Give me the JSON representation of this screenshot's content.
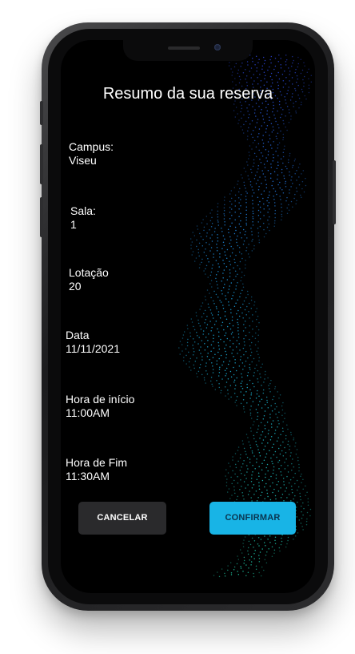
{
  "screen": {
    "title": "Resumo da sua reserva"
  },
  "fields": {
    "campus": {
      "label": "Campus:",
      "value": "Viseu"
    },
    "sala": {
      "label": "Sala:",
      "value": "1"
    },
    "lotacao": {
      "label": "Lotação",
      "value": "20"
    },
    "data": {
      "label": "Data",
      "value": "11/11/2021"
    },
    "hora_inicio": {
      "label": "Hora de início",
      "value": "11:00AM"
    },
    "hora_fim": {
      "label": "Hora de Fim",
      "value": "11:30AM"
    }
  },
  "actions": {
    "cancel_label": "CANCELAR",
    "confirm_label": "CONFIRMAR"
  },
  "colors": {
    "background": "#000000",
    "text": "#ffffff",
    "confirm_button": "#18b4e6",
    "cancel_button": "#2a2a2c",
    "wave_top": "#2a3fd0",
    "wave_mid": "#1aa6e0",
    "wave_bottom": "#20c6a0"
  }
}
